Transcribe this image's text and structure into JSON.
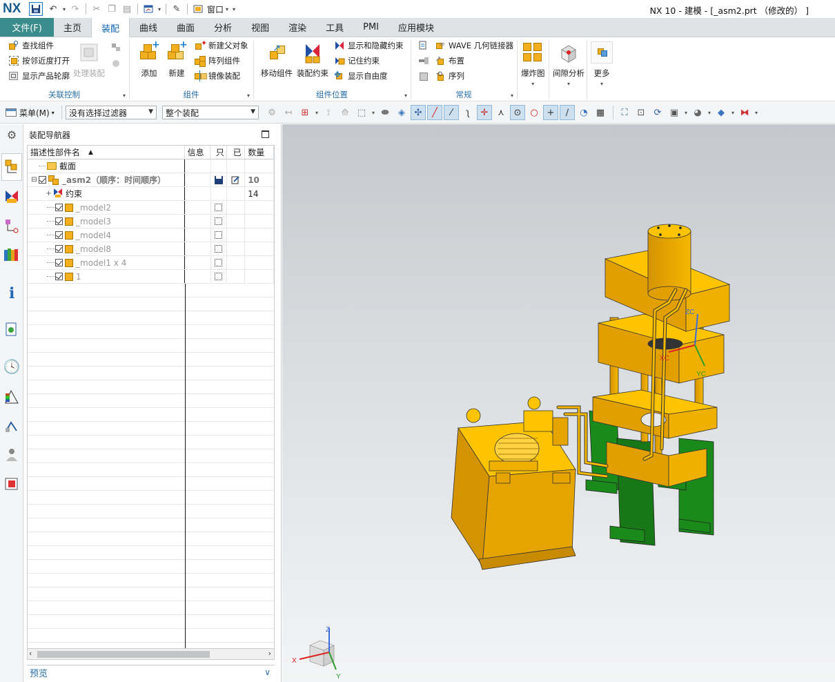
{
  "app": {
    "logo": "NX",
    "title": "NX 10 - 建模 - [_asm2.prt  （修改的） ]",
    "window_menu_label": "窗口"
  },
  "tabs": [
    {
      "label": "文件(F)"
    },
    {
      "label": "主页"
    },
    {
      "label": "装配"
    },
    {
      "label": "曲线"
    },
    {
      "label": "曲面"
    },
    {
      "label": "分析"
    },
    {
      "label": "视图"
    },
    {
      "label": "渲染"
    },
    {
      "label": "工具"
    },
    {
      "label": "PMI"
    },
    {
      "label": "应用模块"
    }
  ],
  "ribbon": {
    "related_control": {
      "label": "关联控制",
      "find_component": "查找组件",
      "open_by_proximity": "按邻近度打开",
      "show_product_outline": "显示产品轮廓",
      "process_assembly": "处理装配"
    },
    "components": {
      "label": "组件",
      "add": "添加",
      "new": "新建",
      "new_parent": "新建父对象",
      "pattern_component": "阵列组件",
      "mirror_assembly": "镜像装配"
    },
    "component_position": {
      "label": "组件位置",
      "move_component": "移动组件",
      "assembly_constraints": "装配约束",
      "show_hide_constraints": "显示和隐藏约束",
      "remember_constraints": "记住约束",
      "show_dof": "显示自由度"
    },
    "general": {
      "label": "常规",
      "wave_linker": "WAVE 几何链接器",
      "arrangement": "布置",
      "sequence": "序列"
    },
    "exploded_view": "爆炸图",
    "clearance_analysis": "间隙分析",
    "more": "更多"
  },
  "toolbar": {
    "menu_label": "菜单(M)",
    "filter_value": "没有选择过滤器",
    "scope_value": "整个装配"
  },
  "navigator": {
    "title": "装配导航器",
    "columns": {
      "name": "描述性部件名",
      "info": "信息",
      "readonly": "只",
      "modified": "已",
      "count": "数量"
    },
    "rows": [
      {
        "name": "截面",
        "count": ""
      },
      {
        "name": "_asm2（顺序：时间顺序）",
        "count": "10"
      },
      {
        "name": "约束",
        "count": "14"
      },
      {
        "name": "_model2",
        "count": ""
      },
      {
        "name": "_model3",
        "count": ""
      },
      {
        "name": "_model4",
        "count": ""
      },
      {
        "name": "_model8",
        "count": ""
      },
      {
        "name": "_model1 x 4",
        "count": ""
      },
      {
        "name": "1",
        "count": ""
      }
    ],
    "preview_label": "预览"
  },
  "viewport": {
    "wcs": {
      "xc": "XC",
      "yc": "YC",
      "zc": "ZC"
    },
    "triad": {
      "x": "X",
      "y": "Y",
      "z": "Z"
    }
  },
  "colors": {
    "part_yellow": "#f5b800",
    "base_green": "#1a8a1a",
    "tab_file": "#3a8d8c",
    "accent_blue": "#0d66b3"
  }
}
